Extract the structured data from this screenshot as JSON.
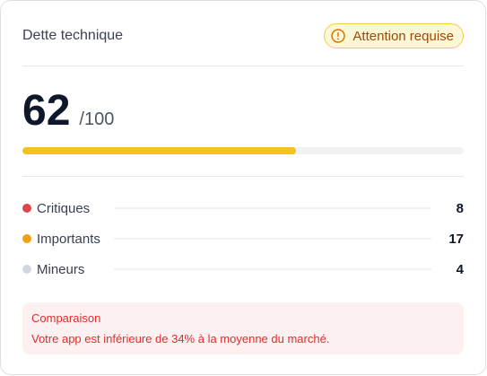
{
  "card": {
    "title": "Dette technique",
    "badge": {
      "label": "Attention requise",
      "icon": "alert-circle-icon"
    }
  },
  "score": {
    "value": "62",
    "max": "/100",
    "progress_percent": 62,
    "progress_color": "#f4c21d"
  },
  "issues": [
    {
      "label": "Critiques",
      "count": "8",
      "color": "#e0454b"
    },
    {
      "label": "Importants",
      "count": "17",
      "color": "#f0a012"
    },
    {
      "label": "Mineurs",
      "count": "4",
      "color": "#d3d6dd"
    }
  ],
  "comparison": {
    "title": "Comparaison",
    "text": "Votre app est inférieure de 34% à la moyenne du marché."
  },
  "colors": {
    "warning_badge_bg": "#fef7d6",
    "warning_badge_border": "#f2cd4d",
    "warning_text": "#9a4a09",
    "danger_bg": "#fdf0f0",
    "danger_text": "#dc2f2f"
  }
}
